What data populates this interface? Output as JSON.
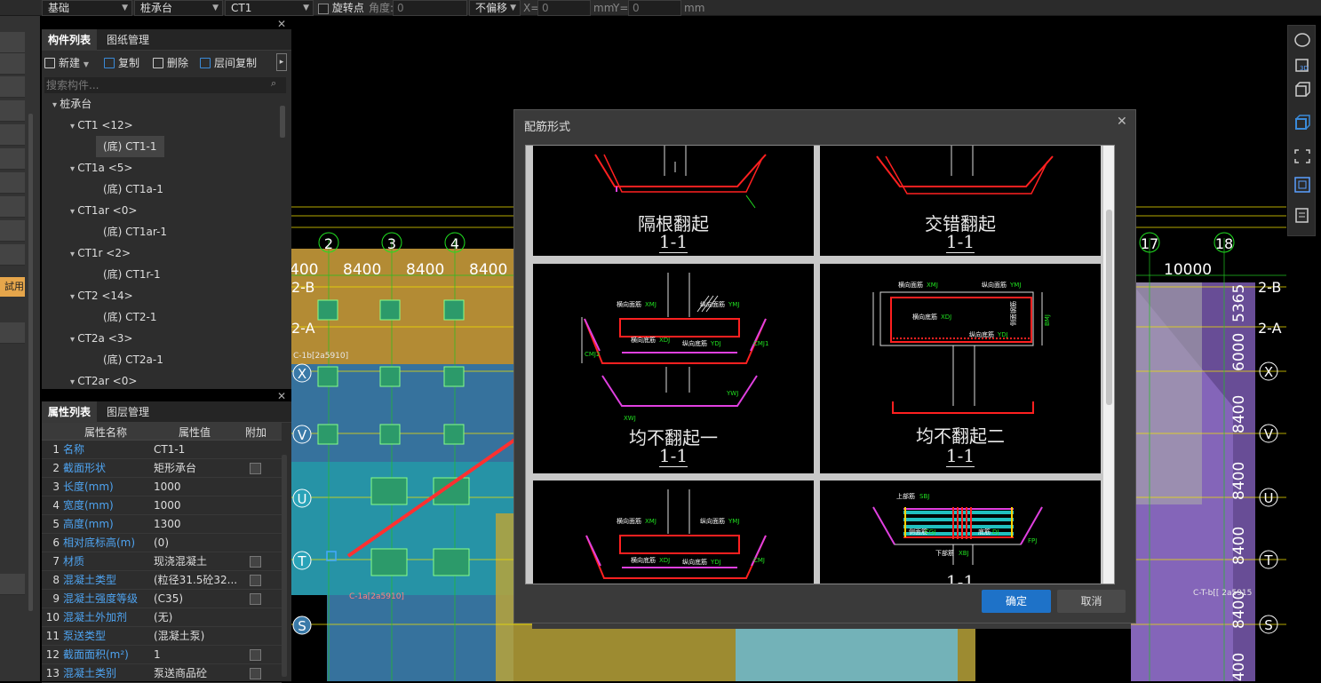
{
  "toolbar": {
    "floor": "基础",
    "type": "桩承台",
    "component": "CT1",
    "rotate_label": "旋转点",
    "angle_label": "角度:",
    "angle_value": "0",
    "offset": "不偏移",
    "x_label": "X=",
    "x_value": "0",
    "mm1": "mm",
    "y_label": "Y=",
    "y_value": "0",
    "mm2": "mm"
  },
  "left_strip": {
    "trial_label": "試用"
  },
  "component_panel": {
    "tabs": [
      "构件列表",
      "图纸管理"
    ],
    "tools": {
      "new": "新建",
      "copy": "复制",
      "delete": "删除",
      "floor_copy": "层间复制"
    },
    "search_placeholder": "搜索构件...",
    "tree": [
      {
        "label": "桩承台",
        "level": 0
      },
      {
        "label": "CT1 <12>",
        "level": 1
      },
      {
        "label": "(底) CT1-1",
        "level": 2,
        "selected": true
      },
      {
        "label": "CT1a <5>",
        "level": 1
      },
      {
        "label": "(底) CT1a-1",
        "level": 2
      },
      {
        "label": "CT1ar <0>",
        "level": 1
      },
      {
        "label": "(底) CT1ar-1",
        "level": 2
      },
      {
        "label": "CT1r <2>",
        "level": 1
      },
      {
        "label": "(底) CT1r-1",
        "level": 2
      },
      {
        "label": "CT2 <14>",
        "level": 1
      },
      {
        "label": "(底) CT2-1",
        "level": 2
      },
      {
        "label": "CT2a <3>",
        "level": 1
      },
      {
        "label": "(底) CT2a-1",
        "level": 2
      },
      {
        "label": "CT2ar <0>",
        "level": 1
      }
    ]
  },
  "property_panel": {
    "tabs": [
      "属性列表",
      "图层管理"
    ],
    "headers": [
      "属性名称",
      "属性值",
      "附加"
    ],
    "rows": [
      {
        "n": "1",
        "k": "名称",
        "v": "CT1-1",
        "chk": false
      },
      {
        "n": "2",
        "k": "截面形状",
        "v": "矩形承台",
        "chk": true
      },
      {
        "n": "3",
        "k": "长度(mm)",
        "v": "1000",
        "chk": false
      },
      {
        "n": "4",
        "k": "宽度(mm)",
        "v": "1000",
        "chk": false
      },
      {
        "n": "5",
        "k": "高度(mm)",
        "v": "1300",
        "chk": false
      },
      {
        "n": "6",
        "k": "相对底标高(m)",
        "v": "(0)",
        "chk": false
      },
      {
        "n": "7",
        "k": "材质",
        "v": "现浇混凝土",
        "chk": true
      },
      {
        "n": "8",
        "k": "混凝土类型",
        "v": "(粒径31.5砼32...",
        "chk": true
      },
      {
        "n": "9",
        "k": "混凝土强度等级",
        "v": "(C35)",
        "chk": true
      },
      {
        "n": "10",
        "k": "混凝土外加剂",
        "v": "(无)",
        "chk": false
      },
      {
        "n": "11",
        "k": "泵送类型",
        "v": "(混凝土泵)",
        "chk": false
      },
      {
        "n": "12",
        "k": "截面面积(m²)",
        "v": "1",
        "chk": true
      },
      {
        "n": "13",
        "k": "混凝土类别",
        "v": "泵送商品砼",
        "chk": true
      }
    ]
  },
  "cad": {
    "axis_numbers": [
      "2",
      "3",
      "4",
      "17",
      "18"
    ],
    "dims": [
      "400",
      "8400",
      "8400",
      "8400",
      "10000"
    ],
    "row_labels_left": [
      "2-B",
      "2-A",
      "X",
      "V",
      "U",
      "T",
      "S"
    ],
    "row_labels_right": [
      "2-B",
      "2-A",
      "X",
      "V",
      "U",
      "T",
      "S"
    ],
    "dims_vertical": [
      "5365",
      "6000",
      "8400",
      "8400",
      "8400",
      "8400",
      "8400"
    ],
    "notes": [
      "C-1b[2a5910]",
      "C-T-b[[ 2a5915",
      "C-1a[2a5910]"
    ]
  },
  "dialog": {
    "title": "配筋形式",
    "options": [
      {
        "title": "隔根翻起",
        "sub": "1-1"
      },
      {
        "title": "交错翻起",
        "sub": "1-1"
      },
      {
        "title": "均不翻起一",
        "sub": "1-1"
      },
      {
        "title": "均不翻起二",
        "sub": "1-1"
      },
      {
        "title": "",
        "sub": ""
      },
      {
        "title": "",
        "sub": "1-1"
      }
    ],
    "annotations": {
      "c3": [
        "横向面筋",
        "XMJ",
        "纵向面筋",
        "YMJ",
        "横向底筋",
        "XDJ",
        "纵向底筋",
        "YDJ",
        "CMJ1",
        "CMJ2",
        "XWJ",
        "YWJ"
      ],
      "c4": [
        "横向面筋",
        "XMJ",
        "纵向面筋",
        "YMJ",
        "横向底筋",
        "XDJ",
        "纵向底筋",
        "YDJ",
        "侧面钢筋",
        "BMJ"
      ],
      "c5": [
        "横向面筋",
        "XMJ",
        "纵向面筋",
        "YMJ",
        "横向底筋",
        "XDJ",
        "纵向底筋",
        "YDJ",
        "CMJ"
      ],
      "c6": [
        "上部筋",
        "SBJ",
        "侧面筋",
        "CGJ",
        "底筋",
        "DJ",
        "下部筋",
        "XBJ",
        "FPJ"
      ]
    },
    "ok": "确定",
    "cancel": "取消"
  },
  "colors": {
    "accent": "#1e72c8",
    "cad_red": "#ff2020",
    "cad_magenta": "#e040e0",
    "cad_green": "#20e020",
    "arrow": "#ff3030"
  }
}
